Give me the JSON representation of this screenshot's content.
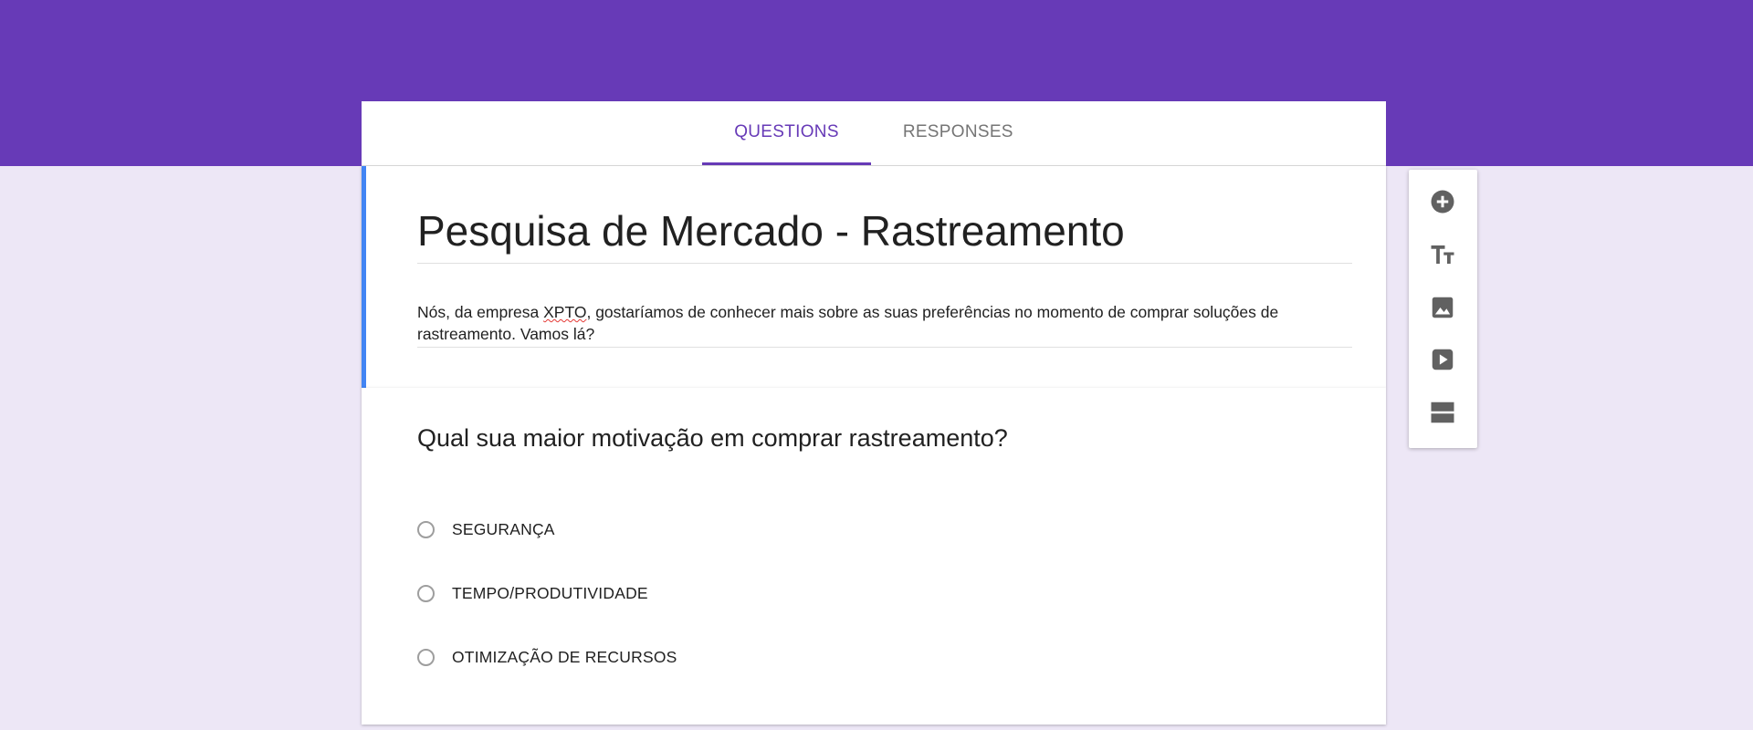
{
  "tabs": [
    {
      "label": "QUESTIONS",
      "active": true
    },
    {
      "label": "RESPONSES",
      "active": false
    }
  ],
  "form": {
    "title": "Pesquisa de Mercado - Rastreamento",
    "description_before": "Nós, da empresa ",
    "description_highlight": "XPTO",
    "description_after": ", gostaríamos de conhecer mais sobre as suas preferências no momento de comprar soluções de rastreamento. Vamos lá?"
  },
  "question": {
    "title": "Qual sua maior motivação em comprar rastreamento?",
    "options": [
      "SEGURANÇA",
      "TEMPO/PRODUTIVIDADE",
      "OTIMIZAÇÃO DE RECURSOS"
    ]
  },
  "toolbar": {
    "icons": [
      "add-question-icon",
      "add-title-icon",
      "add-image-icon",
      "add-video-icon",
      "add-section-icon"
    ]
  },
  "colors": {
    "header": "#673ab7",
    "background": "#ede7f6",
    "accent_bar": "#4285f4",
    "icon": "#616161"
  }
}
